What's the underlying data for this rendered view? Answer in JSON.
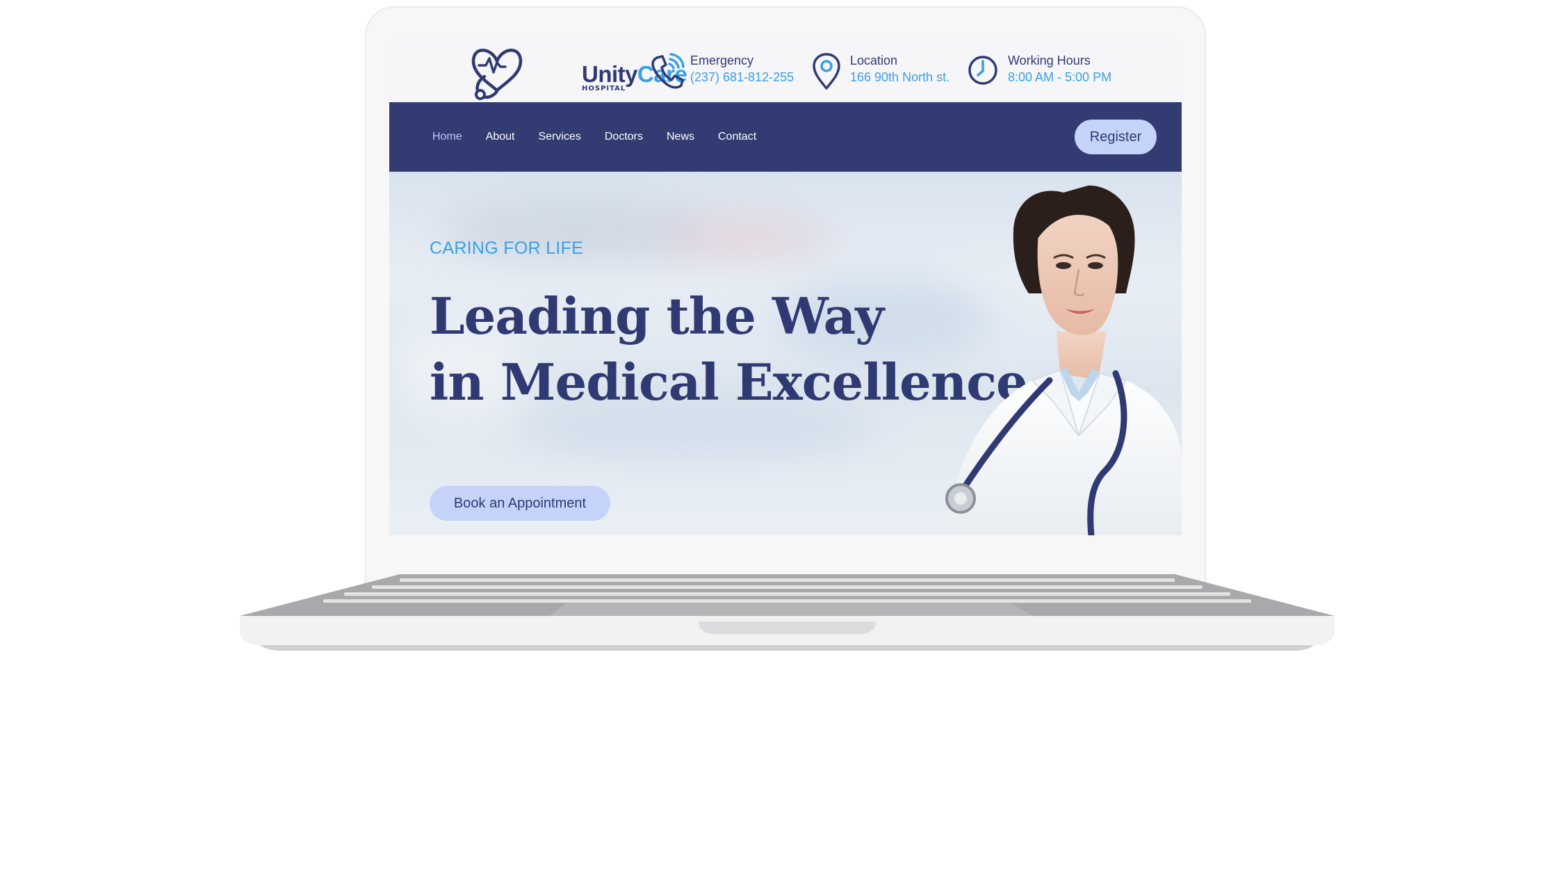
{
  "brand": {
    "name_part1": "Unity",
    "name_part2": "Care",
    "subtitle": "HOSPITAL"
  },
  "info": {
    "emergency": {
      "title": "Emergency",
      "value": "(237) 681-812-255",
      "icon": "phone-icon"
    },
    "location": {
      "title": "Location",
      "value": "166 90th North st.",
      "icon": "location-pin-icon"
    },
    "hours": {
      "title": "Working Hours",
      "value": "8:00 AM - 5:00 PM",
      "icon": "clock-icon"
    }
  },
  "nav": {
    "items": [
      {
        "label": "Home",
        "active": true
      },
      {
        "label": "About"
      },
      {
        "label": "Services"
      },
      {
        "label": "Doctors"
      },
      {
        "label": "News"
      },
      {
        "label": "Contact"
      }
    ],
    "register_label": "Register"
  },
  "hero": {
    "kicker": "CARING FOR LIFE",
    "title_line1": "Leading the Way",
    "title_line2": "in Medical Excellence",
    "cta_label": "Book an Appointment"
  },
  "colors": {
    "navy": "#323b72",
    "accent_blue": "#3a9fe6",
    "button_light": "#c4d3f7"
  }
}
